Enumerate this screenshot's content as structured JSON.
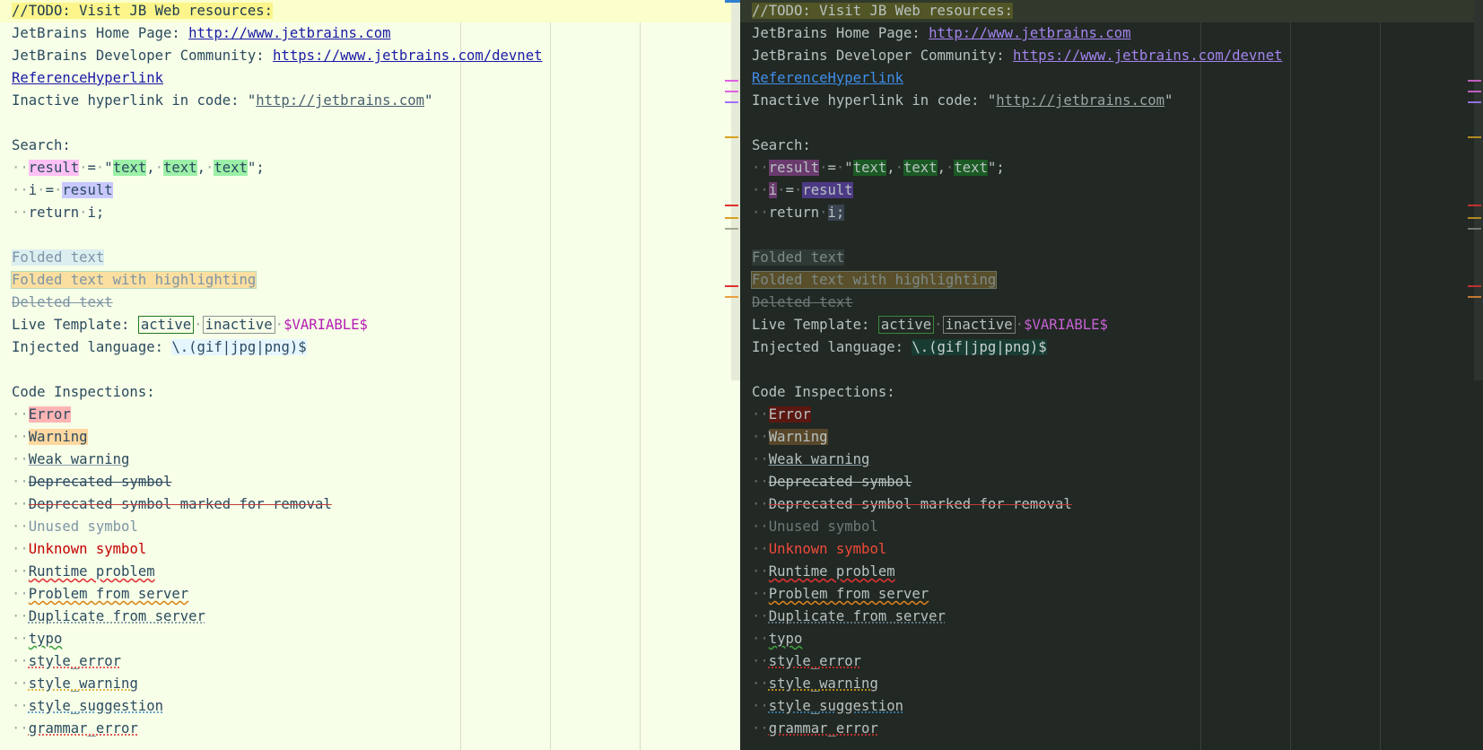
{
  "todo": "//TODO: Visit JB Web resources:",
  "home_label": "JetBrains Home Page: ",
  "home_url": "http://www.jetbrains.com",
  "community_label": "JetBrains Developer Community: ",
  "community_url": "https://www.jetbrains.com/devnet",
  "reference_hyperlink": "ReferenceHyperlink",
  "inactive_label": "Inactive hyperlink in code: ",
  "inactive_url": "http://jetbrains.com",
  "search": {
    "heading": "Search:",
    "result": "result",
    "text": "text",
    "i": "i",
    "return_kw": "return",
    "i_semicolon": "i;"
  },
  "folded_text": "Folded text",
  "folded_highlight": "Folded text with highlighting",
  "deleted_text": "Deleted text",
  "live_template": {
    "label": "Live Template: ",
    "active": "active",
    "inactive": "inactive",
    "variable": "$VARIABLE$"
  },
  "injected": {
    "label": "Injected language: ",
    "code": "\\.(gif|jpg|png)$"
  },
  "inspections": {
    "heading": "Code Inspections:",
    "items": [
      "Error",
      "Warning",
      "Weak warning",
      "Deprecated symbol",
      "Deprecated symbol marked for removal",
      "Unused symbol",
      "Unknown symbol",
      "Runtime problem",
      "Problem from server",
      "Duplicate from server",
      "typo",
      "style_error",
      "style_warning",
      "style_suggestion",
      "grammar_error"
    ]
  },
  "colors": {
    "light_bg": "#f7ffe8",
    "dark_bg": "#222823",
    "scroll_accent": "#2f7fd0"
  }
}
